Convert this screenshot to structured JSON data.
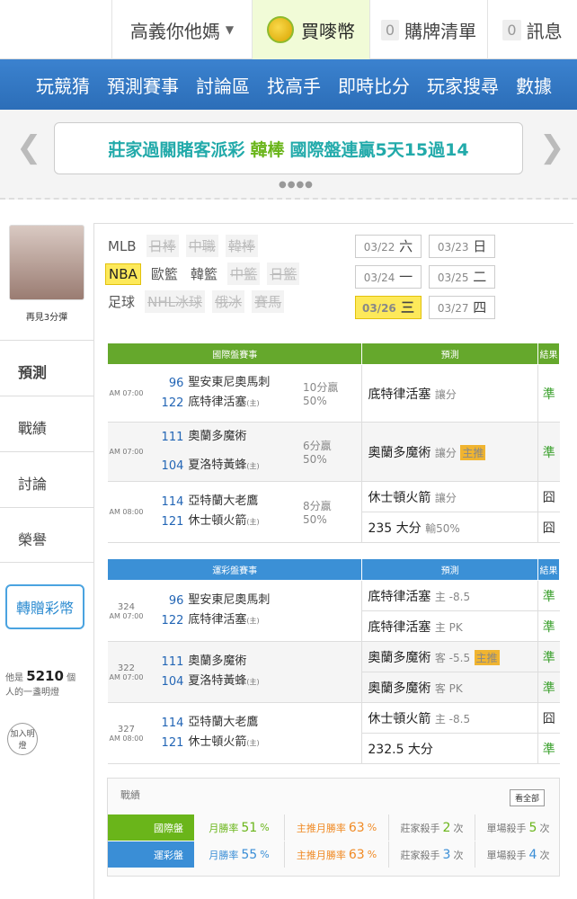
{
  "topbar": {
    "user": "高義你他媽",
    "buy": "買嘜幣",
    "list": "購牌清單",
    "list_count": "0",
    "msg": "訊息",
    "msg_count": "0"
  },
  "nav": [
    "玩競猜",
    "預測賽事",
    "討論區",
    "找高手",
    "即時比分",
    "玩家搜尋",
    "數據"
  ],
  "banner": {
    "text_a": "莊家過關賭客派彩",
    "text_b": "韓棒",
    "text_c": "國際盤連贏5天15過14",
    "dots": "●●●●"
  },
  "side": {
    "name": "再見3分彈",
    "tabs": [
      "預測",
      "戰績",
      "討論",
      "榮譽"
    ],
    "gift": "轉贈彩幣",
    "count_pre": "他是",
    "count": "5210",
    "count_post": "個",
    "count_line2": "人的一盞明燈",
    "join": "加入明燈"
  },
  "leagues": [
    "MLB",
    "日棒",
    "中職",
    "韓棒",
    "NBA",
    "歐籃",
    "韓籃",
    "中籃",
    "日籃",
    "足球",
    "NHL冰球",
    "俄冰",
    "賽馬"
  ],
  "dates": [
    {
      "d": "03/22",
      "w": "六"
    },
    {
      "d": "03/23",
      "w": "日"
    },
    {
      "d": "03/24",
      "w": "一"
    },
    {
      "d": "03/25",
      "w": "二"
    },
    {
      "d": "03/26",
      "w": "三"
    },
    {
      "d": "03/27",
      "w": "四"
    }
  ],
  "intl": {
    "h1": "國際盤賽事",
    "h2": "預測",
    "h3": "結果",
    "rows": [
      {
        "time": "AM 07:00",
        "s1": "96",
        "t1": "聖安東尼奧馬刺",
        "s2": "122",
        "t2": "底特律活塞",
        "odds1": "10分贏",
        "odds2": "50%",
        "pick": "底特律活塞",
        "pick_type": "讓分",
        "result": "準"
      },
      {
        "time": "AM 07:00",
        "s1": "111",
        "t1": "奧蘭多魔術",
        "s2": "104",
        "t2": "夏洛特黃蜂",
        "odds1": "6分贏",
        "odds2": "50%",
        "pick": "奧蘭多魔術",
        "pick_type": "讓分",
        "result": "準"
      },
      {
        "time": "AM 08:00",
        "s1": "114",
        "t1": "亞特蘭大老鷹",
        "s2": "121",
        "t2": "休士頓火箭",
        "odds1": "8分贏",
        "odds2": "50%",
        "pick": "休士頓火箭",
        "pick_type": "讓分",
        "result": "囧",
        "pick2": "235 大分",
        "pick2_type": "輸50%",
        "result2": "囧"
      }
    ]
  },
  "lottery": {
    "h1": "運彩盤賽事",
    "h2": "預測",
    "h3": "結果",
    "rows": [
      {
        "no": "324",
        "time": "AM 07:00",
        "s1": "96",
        "t1": "聖安東尼奧馬刺",
        "s2": "122",
        "t2": "底特律活塞",
        "pick": "底特律活塞",
        "pick_type": "主 -8.5",
        "result": "準",
        "pick2": "底特律活塞",
        "pick2_type": "主 PK",
        "result2": "準"
      },
      {
        "no": "322",
        "time": "AM 07:00",
        "s1": "111",
        "t1": "奧蘭多魔術",
        "s2": "104",
        "t2": "夏洛特黃蜂",
        "pick": "奧蘭多魔術",
        "pick_type": "客 -5.5",
        "result": "準",
        "pick2": "奧蘭多魔術",
        "pick2_type": "客 PK",
        "result2": "準"
      },
      {
        "no": "327",
        "time": "AM 08:00",
        "s1": "114",
        "t1": "亞特蘭大老鷹",
        "s2": "121",
        "t2": "休士頓火箭",
        "pick": "休士頓火箭",
        "pick_type": "主 -8.5",
        "result": "囧",
        "pick2": "232.5 大分",
        "pick2_type": "",
        "result2": "準"
      }
    ]
  },
  "home_tag": "(主)",
  "badge": "主推",
  "stats": {
    "title": "戰績",
    "all": "看全部",
    "rows": [
      {
        "label": "國際盤",
        "rate_lab": "月勝率",
        "rate": "51",
        "main_lab": "主推月勝率",
        "main": "63",
        "kill_lab": "莊家殺手",
        "kill": "2",
        "single_lab": "單場殺手",
        "single": "5"
      },
      {
        "label": "運彩盤",
        "rate_lab": "月勝率",
        "rate": "55",
        "main_lab": "主推月勝率",
        "main": "63",
        "kill_lab": "莊家殺手",
        "kill": "3",
        "single_lab": "單場殺手",
        "single": "4"
      }
    ]
  }
}
